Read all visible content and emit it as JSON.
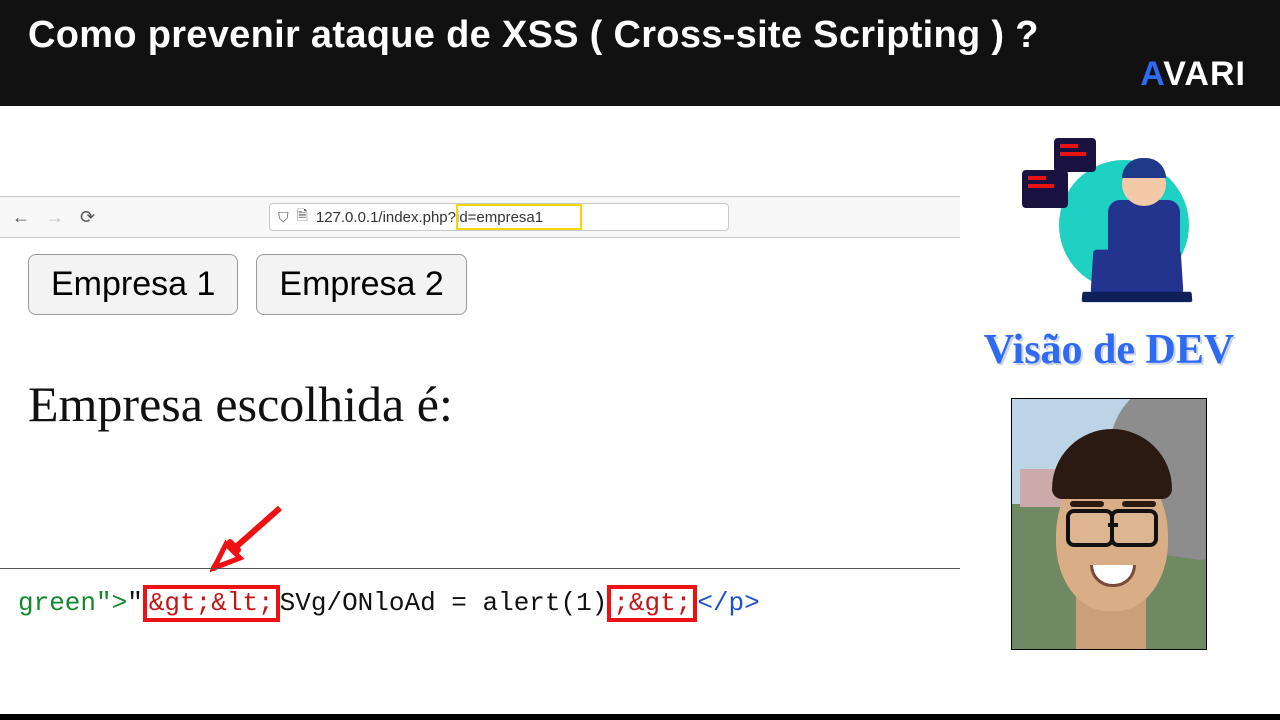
{
  "banner": {
    "title": "Como prevenir ataque de XSS ( Cross-site Scripting ) ?",
    "brand_a": "A",
    "brand_rest": "VARI"
  },
  "browser": {
    "back_glyph": "←",
    "fwd_glyph": "→",
    "reload_glyph": "⟳",
    "shield_glyph": "⛉",
    "page_glyph": "🗎",
    "url_left": "127.0.0.1/index.ph",
    "url_right": "p?id=empresa1"
  },
  "buttons": {
    "b1": "Empresa 1",
    "b2": "Empresa 2"
  },
  "headline": "Empresa escolhida é:",
  "code": {
    "seg_green": "green\">",
    "seg_quote": "\"",
    "seg_box1": "&gt;&lt;",
    "seg_mid1": "SVg/ONloAd = alert(1",
    "seg_box2": ";&gt;",
    "seg_tag": "</p>"
  },
  "right": {
    "label": "Visão de DEV"
  }
}
